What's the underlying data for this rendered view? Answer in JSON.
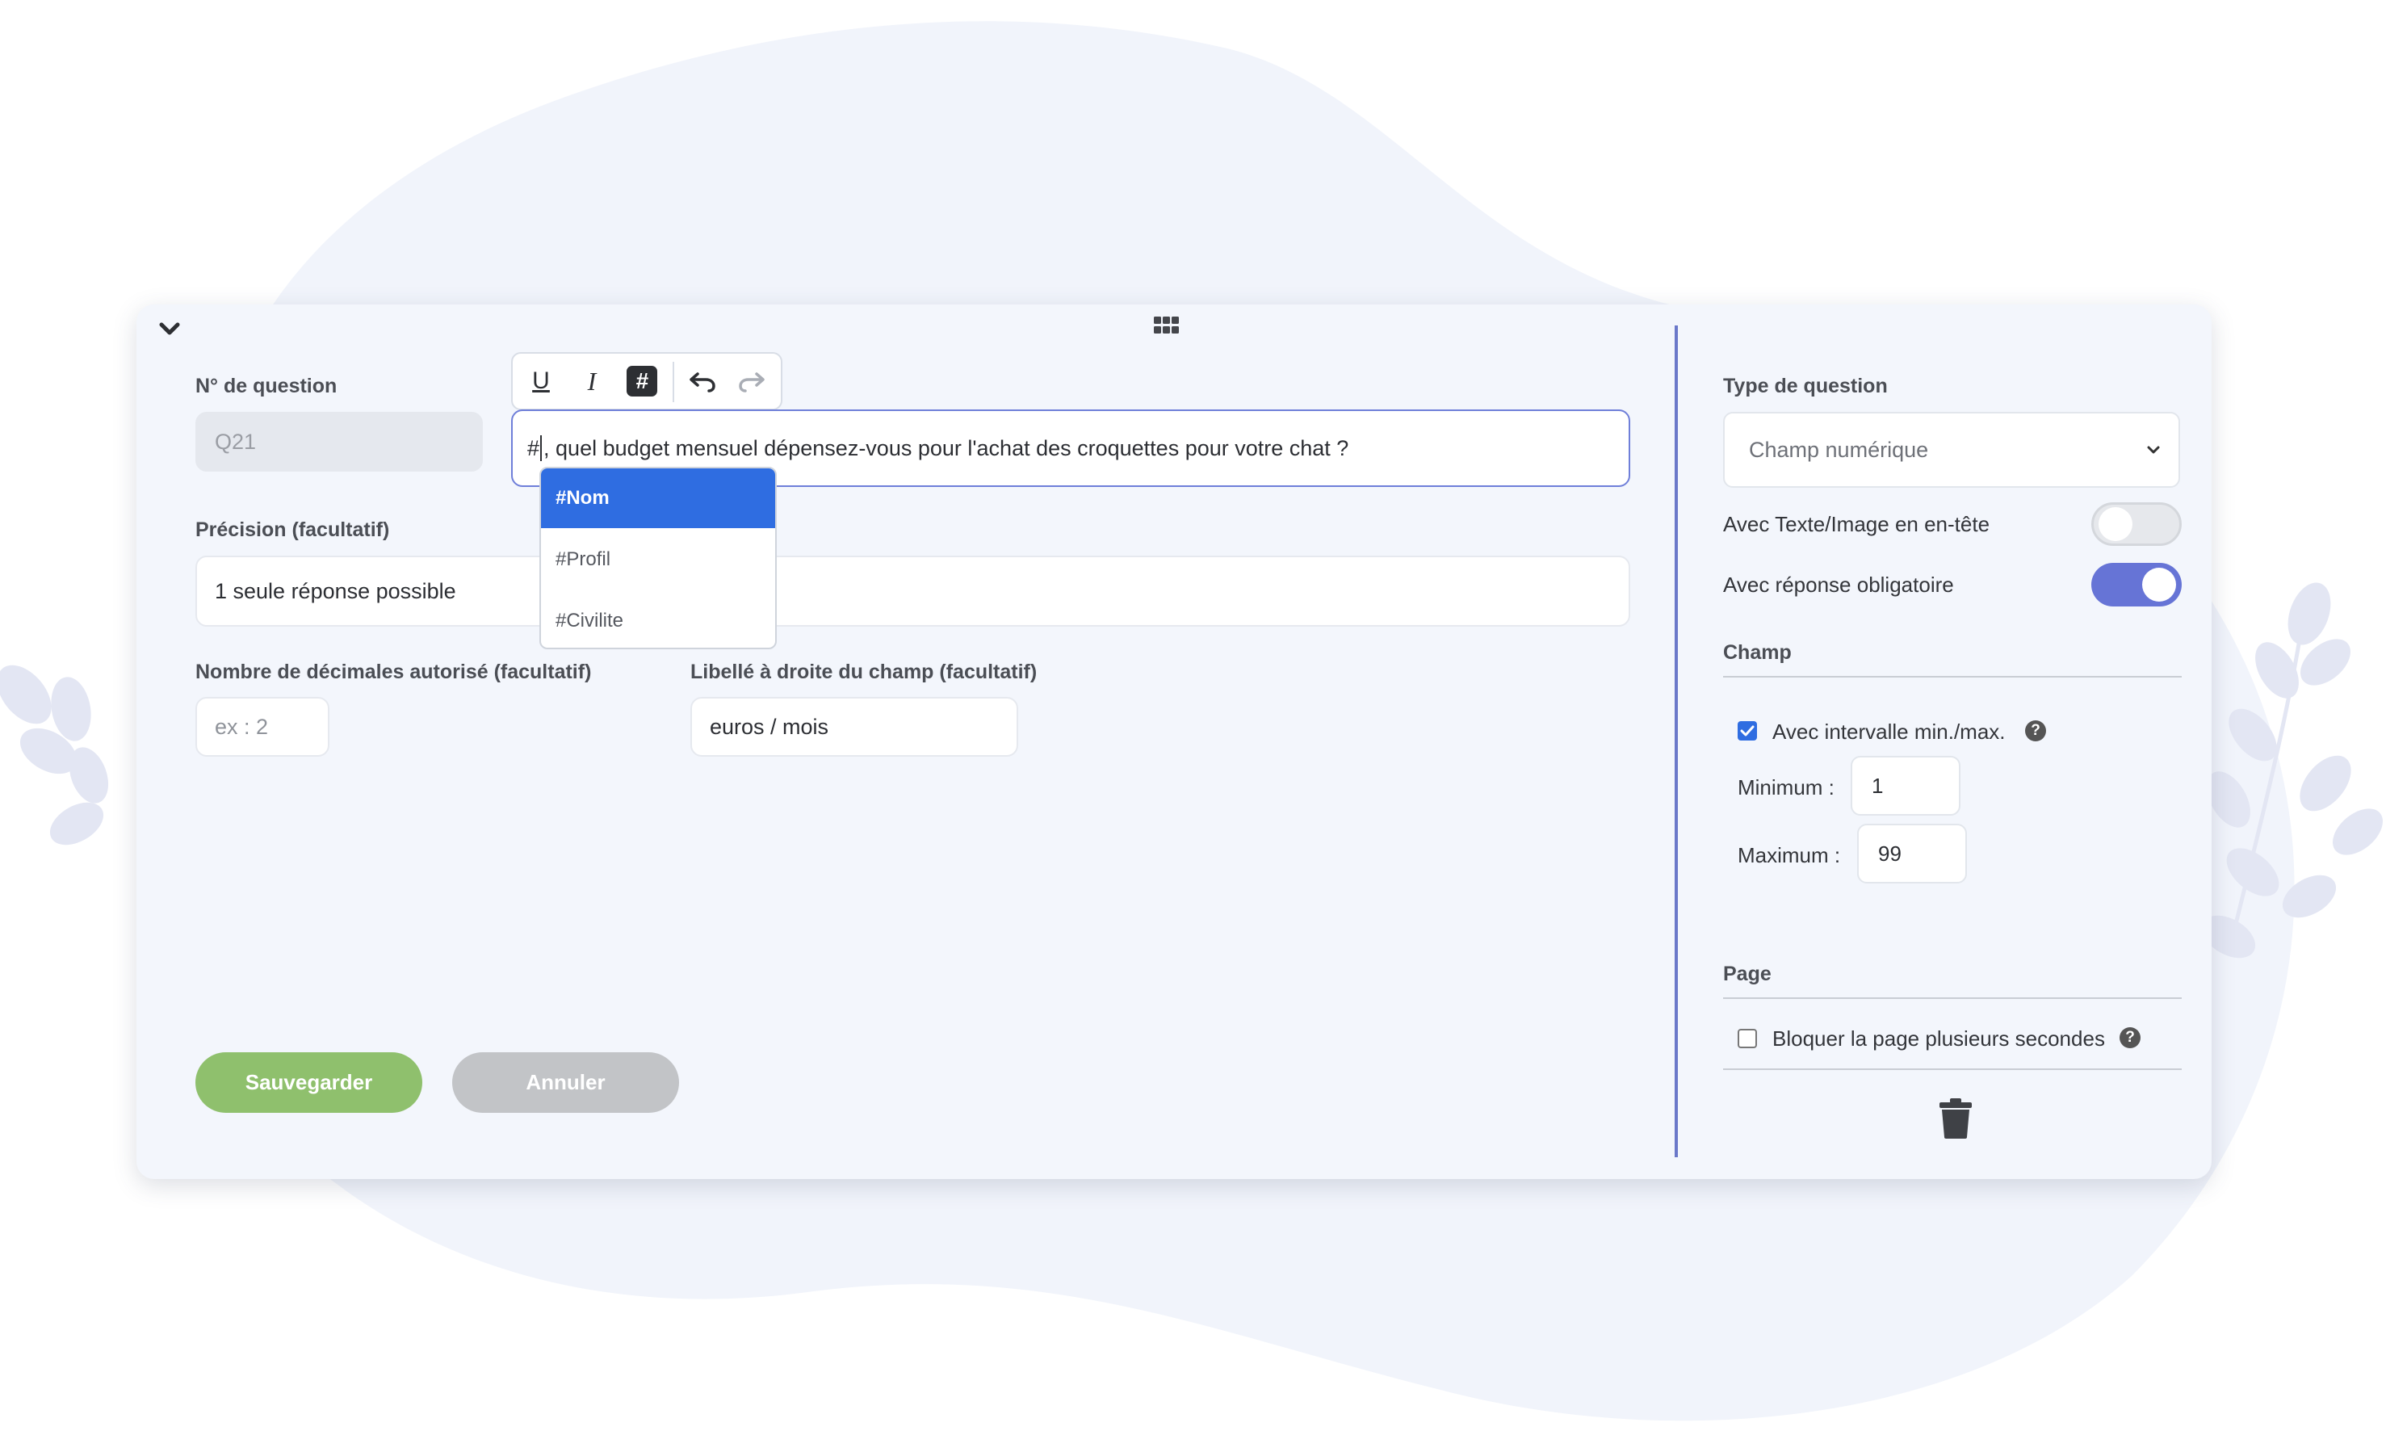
{
  "editor": {
    "question_number_label": "N° de question",
    "question_number_value": "Q21",
    "toolbar": {
      "underline": "U",
      "italic": "I",
      "variable": "#"
    },
    "question_text_prefix": "#",
    "question_text": ", quel budget mensuel dépensez-vous pour l'achat des croquettes pour votre chat ?",
    "variable_options": [
      "#Nom",
      "#Profil",
      "#Civilite"
    ],
    "selected_option_index": 0,
    "precision_label": "Précision (facultatif)",
    "precision_value": "1 seule réponse possible",
    "decimals_label": "Nombre de décimales autorisé (facultatif)",
    "decimals_placeholder": "ex : 2",
    "right_label_label": "Libellé à droite du champ (facultatif)",
    "right_label_value": "euros / mois",
    "save_label": "Sauvegarder",
    "cancel_label": "Annuler"
  },
  "settings": {
    "type_label": "Type de question",
    "type_value": "Champ numérique",
    "header_media_label": "Avec Texte/Image en en-tête",
    "header_media_on": false,
    "required_label": "Avec réponse obligatoire",
    "required_on": true,
    "field_section": "Champ",
    "range_label": "Avec intervalle min./max.",
    "range_checked": true,
    "min_label": "Minimum :",
    "min_value": "1",
    "max_label": "Maximum :",
    "max_value": "99",
    "page_section": "Page",
    "block_page_label": "Bloquer la page plusieurs secondes",
    "block_page_checked": false,
    "help_glyph": "?"
  },
  "colors": {
    "accent": "#6674d6",
    "selected": "#2f6de1",
    "save": "#8fc06d",
    "cancel": "#c2c4c7"
  }
}
